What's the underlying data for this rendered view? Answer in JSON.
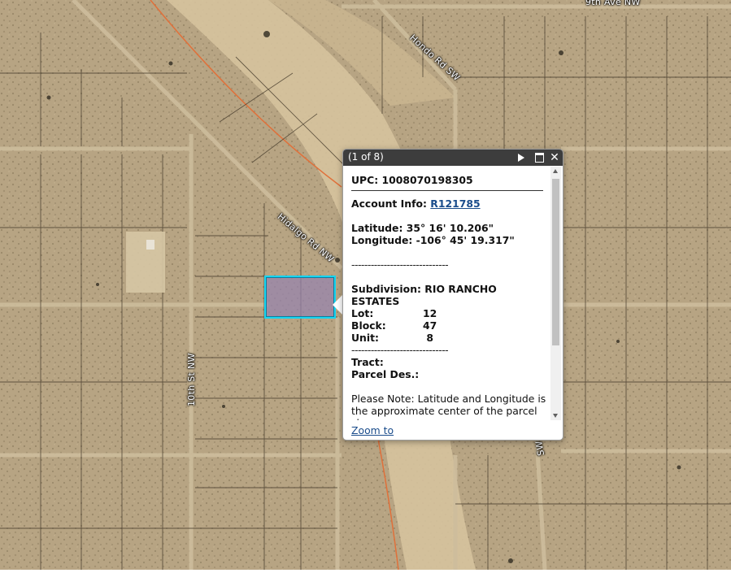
{
  "map": {
    "road_labels": {
      "ninth_ave": "9th Ave NW",
      "hondo_rd": "Hondo Rd SW",
      "hidalgo_rd": "Hidalgo Rd NW",
      "tenth_st": "10th St NW",
      "sw_partial": "SW"
    },
    "colors": {
      "terrain": "#b9a585",
      "lot_line": "#3f3526",
      "wash": "#dcc9a6",
      "utility_line": "#e0703a",
      "parcel_highlight": "#18d4f0"
    }
  },
  "popup": {
    "title": "(1 of 8)",
    "upc_label": "UPC:",
    "upc_value": "1008070198305",
    "account_label": "Account Info:",
    "account_value": "R121785",
    "latitude_label": "Latitude:",
    "latitude_value": "35° 16' 10.206\"",
    "longitude_label": "Longitude:",
    "longitude_value": "-106° 45' 19.317\"",
    "separator": "------------------------------",
    "subdivision_label": "Subdivision:",
    "subdivision_value": "RIO RANCHO ESTATES",
    "lot_label": "Lot:",
    "lot_value": "12",
    "block_label": "Block:",
    "block_value": "47",
    "unit_label": "Unit:",
    "unit_value": " 8",
    "tract_label": "Tract:",
    "parcel_des_label": "Parcel Des.:",
    "note": "Please Note: Latitude and Longitude is the approximate center of the parcel shown.",
    "zoom_to": "Zoom to"
  }
}
